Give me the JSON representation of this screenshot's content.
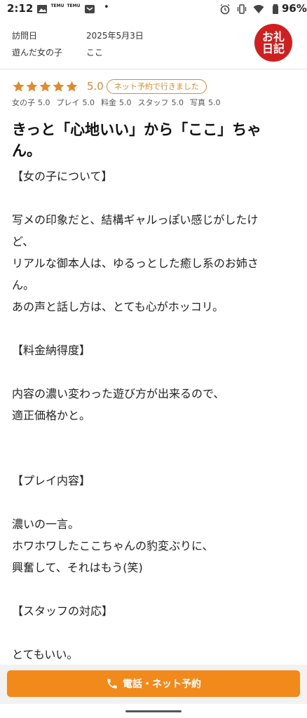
{
  "status_bar": {
    "time": "2:12",
    "temu_1": "TEMU",
    "temu_2": "TEMU",
    "dot": "•",
    "battery": "96%"
  },
  "meta": {
    "visit_label": "訪問日",
    "visit_value": "2025年5月3日",
    "girl_label": "遊んだ女の子",
    "girl_value": "ここ"
  },
  "stamp": {
    "line1": "お礼",
    "line2": "日記"
  },
  "rating": {
    "stars": 5,
    "max_stars": 5,
    "value": "5.0",
    "badge": "ネット予約で行きました",
    "star_color": "#e08a2b"
  },
  "sub_scores": [
    {
      "label": "女の子",
      "value": "5.0"
    },
    {
      "label": "プレイ",
      "value": "5.0"
    },
    {
      "label": "料金",
      "value": "5.0"
    },
    {
      "label": "スタッフ",
      "value": "5.0"
    },
    {
      "label": "写真",
      "value": "5.0"
    }
  ],
  "title_line1": "きっと「心地いい」から「ここ」ちゃ",
  "title_line2": "ん。",
  "body_lines": [
    "【女の子について】",
    "",
    "写メの印象だと、結構ギャルっぽい感じがしたけ",
    "ど、",
    "リアルな御本人は、ゆるっとした癒し系のお姉さ",
    "ん。",
    "あの声と話し方は、とても心がホッコリ。",
    "",
    "【料金納得度】",
    "",
    "内容の濃い変わった遊び方が出来るので、",
    "適正価格かと。",
    "",
    "",
    "【プレイ内容】",
    "",
    "濃いの一言。",
    "ホワホワしたここちゃんの豹変ぶりに、",
    "興奮して、それはもう(笑)",
    "",
    "【スタッフの対応】",
    "",
    "とてもいい。"
  ],
  "cta": {
    "label": "電話・ネット予約",
    "color": "#f28a1b"
  }
}
